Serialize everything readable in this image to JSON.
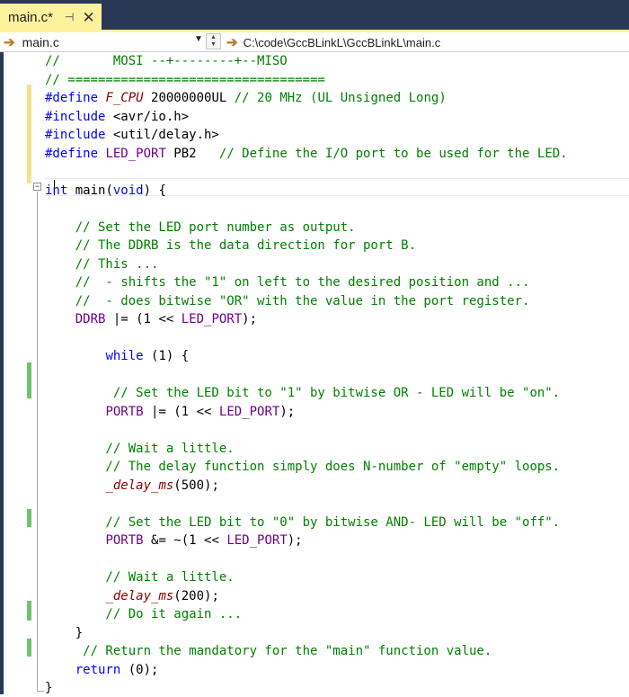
{
  "tab": {
    "title": "main.c*",
    "pin_glyph": "⊣",
    "close_glyph": "✕"
  },
  "nav": {
    "scope": "main.c",
    "member_path": "C:\\code\\GccBLinkL\\GccBLinkL\\main.c"
  },
  "colors": {
    "title_bar": "#293955",
    "active_tab": "#fff29d",
    "comment": "#008000",
    "keyword": "#0000ff",
    "macro": "#6f008a",
    "function": "#880000",
    "saved_change": "#6cc56c",
    "unsaved_change": "#f0e48c"
  },
  "code_lines": [
    [
      {
        "t": "//       MOSI --+--------+--MISO",
        "k": "c"
      }
    ],
    [
      {
        "t": "// ==================================",
        "k": "c"
      }
    ],
    [
      {
        "t": "#define ",
        "k": "k"
      },
      {
        "t": "F_CPU",
        "k": "f"
      },
      {
        "t": " 20000000UL ",
        "k": ""
      },
      {
        "t": "// 20 MHz (UL Unsigned Long)",
        "k": "c"
      }
    ],
    [
      {
        "t": "#include ",
        "k": "k"
      },
      {
        "t": "<avr/io.h>",
        "k": ""
      }
    ],
    [
      {
        "t": "#include ",
        "k": "k"
      },
      {
        "t": "<util/delay.h>",
        "k": ""
      }
    ],
    [
      {
        "t": "#define ",
        "k": "k"
      },
      {
        "t": "LED_PORT",
        "k": "m"
      },
      {
        "t": " PB2   ",
        "k": ""
      },
      {
        "t": "// Define the I/O port to be used for the LED.",
        "k": "c"
      }
    ],
    [],
    [
      {
        "t": "int",
        "k": "k"
      },
      {
        "t": " main(",
        "k": ""
      },
      {
        "t": "void",
        "k": "k"
      },
      {
        "t": ") {",
        "k": ""
      }
    ],
    [],
    [
      {
        "t": "    // Set the LED port number as output.",
        "k": "c"
      }
    ],
    [
      {
        "t": "    // The DDRB is the data direction for port B.",
        "k": "c"
      }
    ],
    [
      {
        "t": "    // This ...",
        "k": "c"
      }
    ],
    [
      {
        "t": "    //  - shifts the \"1\" on left to the desired position and ...",
        "k": "c"
      }
    ],
    [
      {
        "t": "    //  - does bitwise \"OR\" with the value in the port register.",
        "k": "c"
      }
    ],
    [
      {
        "t": "    ",
        "k": ""
      },
      {
        "t": "DDRB",
        "k": "m"
      },
      {
        "t": " |= (1 << ",
        "k": ""
      },
      {
        "t": "LED_PORT",
        "k": "m"
      },
      {
        "t": ");",
        "k": ""
      }
    ],
    [],
    [
      {
        "t": "        ",
        "k": ""
      },
      {
        "t": "while",
        "k": "k"
      },
      {
        "t": " (1) {",
        "k": ""
      }
    ],
    [],
    [
      {
        "t": "         // Set the LED bit to \"1\" by bitwise OR - LED will be \"on\".",
        "k": "c"
      }
    ],
    [
      {
        "t": "        ",
        "k": ""
      },
      {
        "t": "PORTB",
        "k": "m"
      },
      {
        "t": " |= (1 << ",
        "k": ""
      },
      {
        "t": "LED_PORT",
        "k": "m"
      },
      {
        "t": ");",
        "k": ""
      }
    ],
    [],
    [
      {
        "t": "        // Wait a little.",
        "k": "c"
      }
    ],
    [
      {
        "t": "        // The delay function simply does N-number of \"empty\" loops.",
        "k": "c"
      }
    ],
    [
      {
        "t": "        ",
        "k": ""
      },
      {
        "t": "_delay_ms",
        "k": "f"
      },
      {
        "t": "(500);",
        "k": ""
      }
    ],
    [],
    [
      {
        "t": "        // Set the LED bit to \"0\" by bitwise AND- LED will be \"off\".",
        "k": "c"
      }
    ],
    [
      {
        "t": "        ",
        "k": ""
      },
      {
        "t": "PORTB",
        "k": "m"
      },
      {
        "t": " &= ~(1 << ",
        "k": ""
      },
      {
        "t": "LED_PORT",
        "k": "m"
      },
      {
        "t": ");",
        "k": ""
      }
    ],
    [],
    [
      {
        "t": "        // Wait a little.",
        "k": "c"
      }
    ],
    [
      {
        "t": "        ",
        "k": ""
      },
      {
        "t": "_delay_ms",
        "k": "f"
      },
      {
        "t": "(200);",
        "k": ""
      }
    ],
    [
      {
        "t": "        // Do it again ...",
        "k": "c"
      }
    ],
    [
      {
        "t": "    }",
        "k": ""
      }
    ],
    [
      {
        "t": "     // Return the mandatory for the \"main\" function value.",
        "k": "c"
      }
    ],
    [
      {
        "t": "    ",
        "k": ""
      },
      {
        "t": "return",
        "k": "k"
      },
      {
        "t": " (0);",
        "k": ""
      }
    ],
    [
      {
        "t": "}",
        "k": ""
      }
    ]
  ]
}
